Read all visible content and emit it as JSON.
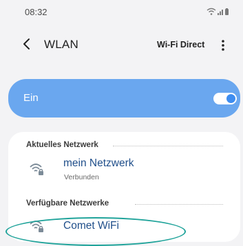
{
  "status_bar": {
    "time": "08:32",
    "icons": [
      "wifi-icon",
      "signal-icon",
      "battery-icon"
    ]
  },
  "app_bar": {
    "title": "WLAN",
    "wifi_direct_label": "Wi-Fi Direct"
  },
  "master_toggle": {
    "label": "Ein",
    "on": true
  },
  "sections": {
    "current": {
      "title": "Aktuelles Netzwerk"
    },
    "available": {
      "title": "Verfügbare Netzwerke"
    }
  },
  "networks": {
    "current": {
      "name": "mein Netzwerk",
      "status": "Verbunden",
      "icon": "wifi-lock-icon"
    },
    "available": [
      {
        "name": "Comet WiFi",
        "icon": "wifi-lock-icon"
      }
    ]
  },
  "colors": {
    "accent": "#6aa7ef",
    "network_name": "#1f4e8a",
    "highlight": "#1fa39a",
    "background": "#f3f3f5"
  }
}
